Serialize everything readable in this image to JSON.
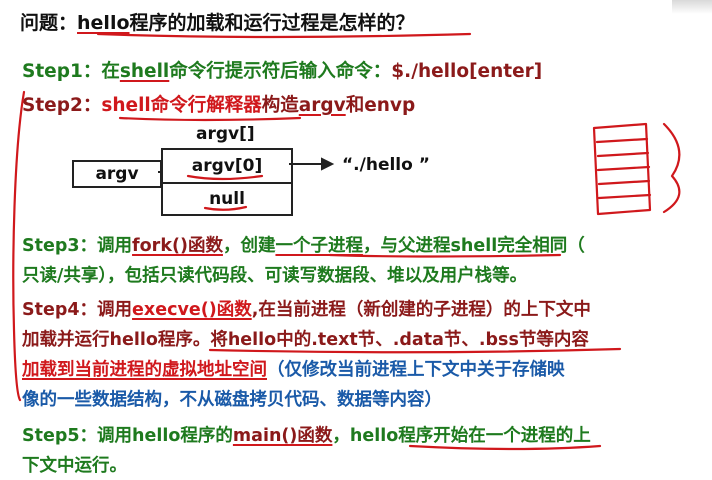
{
  "title": {
    "prefix": "问题：",
    "hello": "hello",
    "rest": "程序的加载和运行过程是怎样的？"
  },
  "step1": {
    "label": "Step1：",
    "a": "在",
    "shell": "shell",
    "b": "命令行提示符后输入命令：",
    "cmd": "$./hello[enter]"
  },
  "step2": {
    "label": "Step2：",
    "a": "shell命令行解释器",
    "b": "构造",
    "c": "argv",
    "d": "和",
    "e": "envp"
  },
  "diagram": {
    "argv_top": "argv[]",
    "argv_label": "argv",
    "cell0": "argv[0]",
    "cell1": "null",
    "string": "“./hello ”"
  },
  "step3": {
    "label": "Step3：",
    "a": "调用",
    "fork": "fork()函数",
    "b": "，创建",
    "c": "一个子进程",
    "d": "，与父进程",
    "e": "shell",
    "f": "完全相同（",
    "line2": "只读/共享），包括只读代码段、可读写数据段、堆以及用户栈等。"
  },
  "step4": {
    "label": "Step4：",
    "a": "调用",
    "execve": "execve()函数",
    "b": ",在当前进程（新创建的子进程）的上下文中",
    "line2": "加载并运行hello程序。将hello中的.text节、.data节、.bss节等内容",
    "line3_red": "加载到当前进程的虚拟地址空间",
    "line3_blue": "（仅修改当前进程上下文中关于存储映",
    "line4_blue": "像的一些数据结构，不从磁盘拷贝代码、数据等内容）"
  },
  "step5": {
    "label": "Step5：",
    "a": "调用hello程序的",
    "main": "main()函数",
    "b": "，hello程序开始在一个进程的上",
    "line2": "下文中运行。"
  },
  "colors": {
    "green": "#1e7a1e",
    "brown": "#8b1a1a",
    "red": "#d0181c",
    "blue": "#1a5aa8",
    "black": "#111111"
  }
}
